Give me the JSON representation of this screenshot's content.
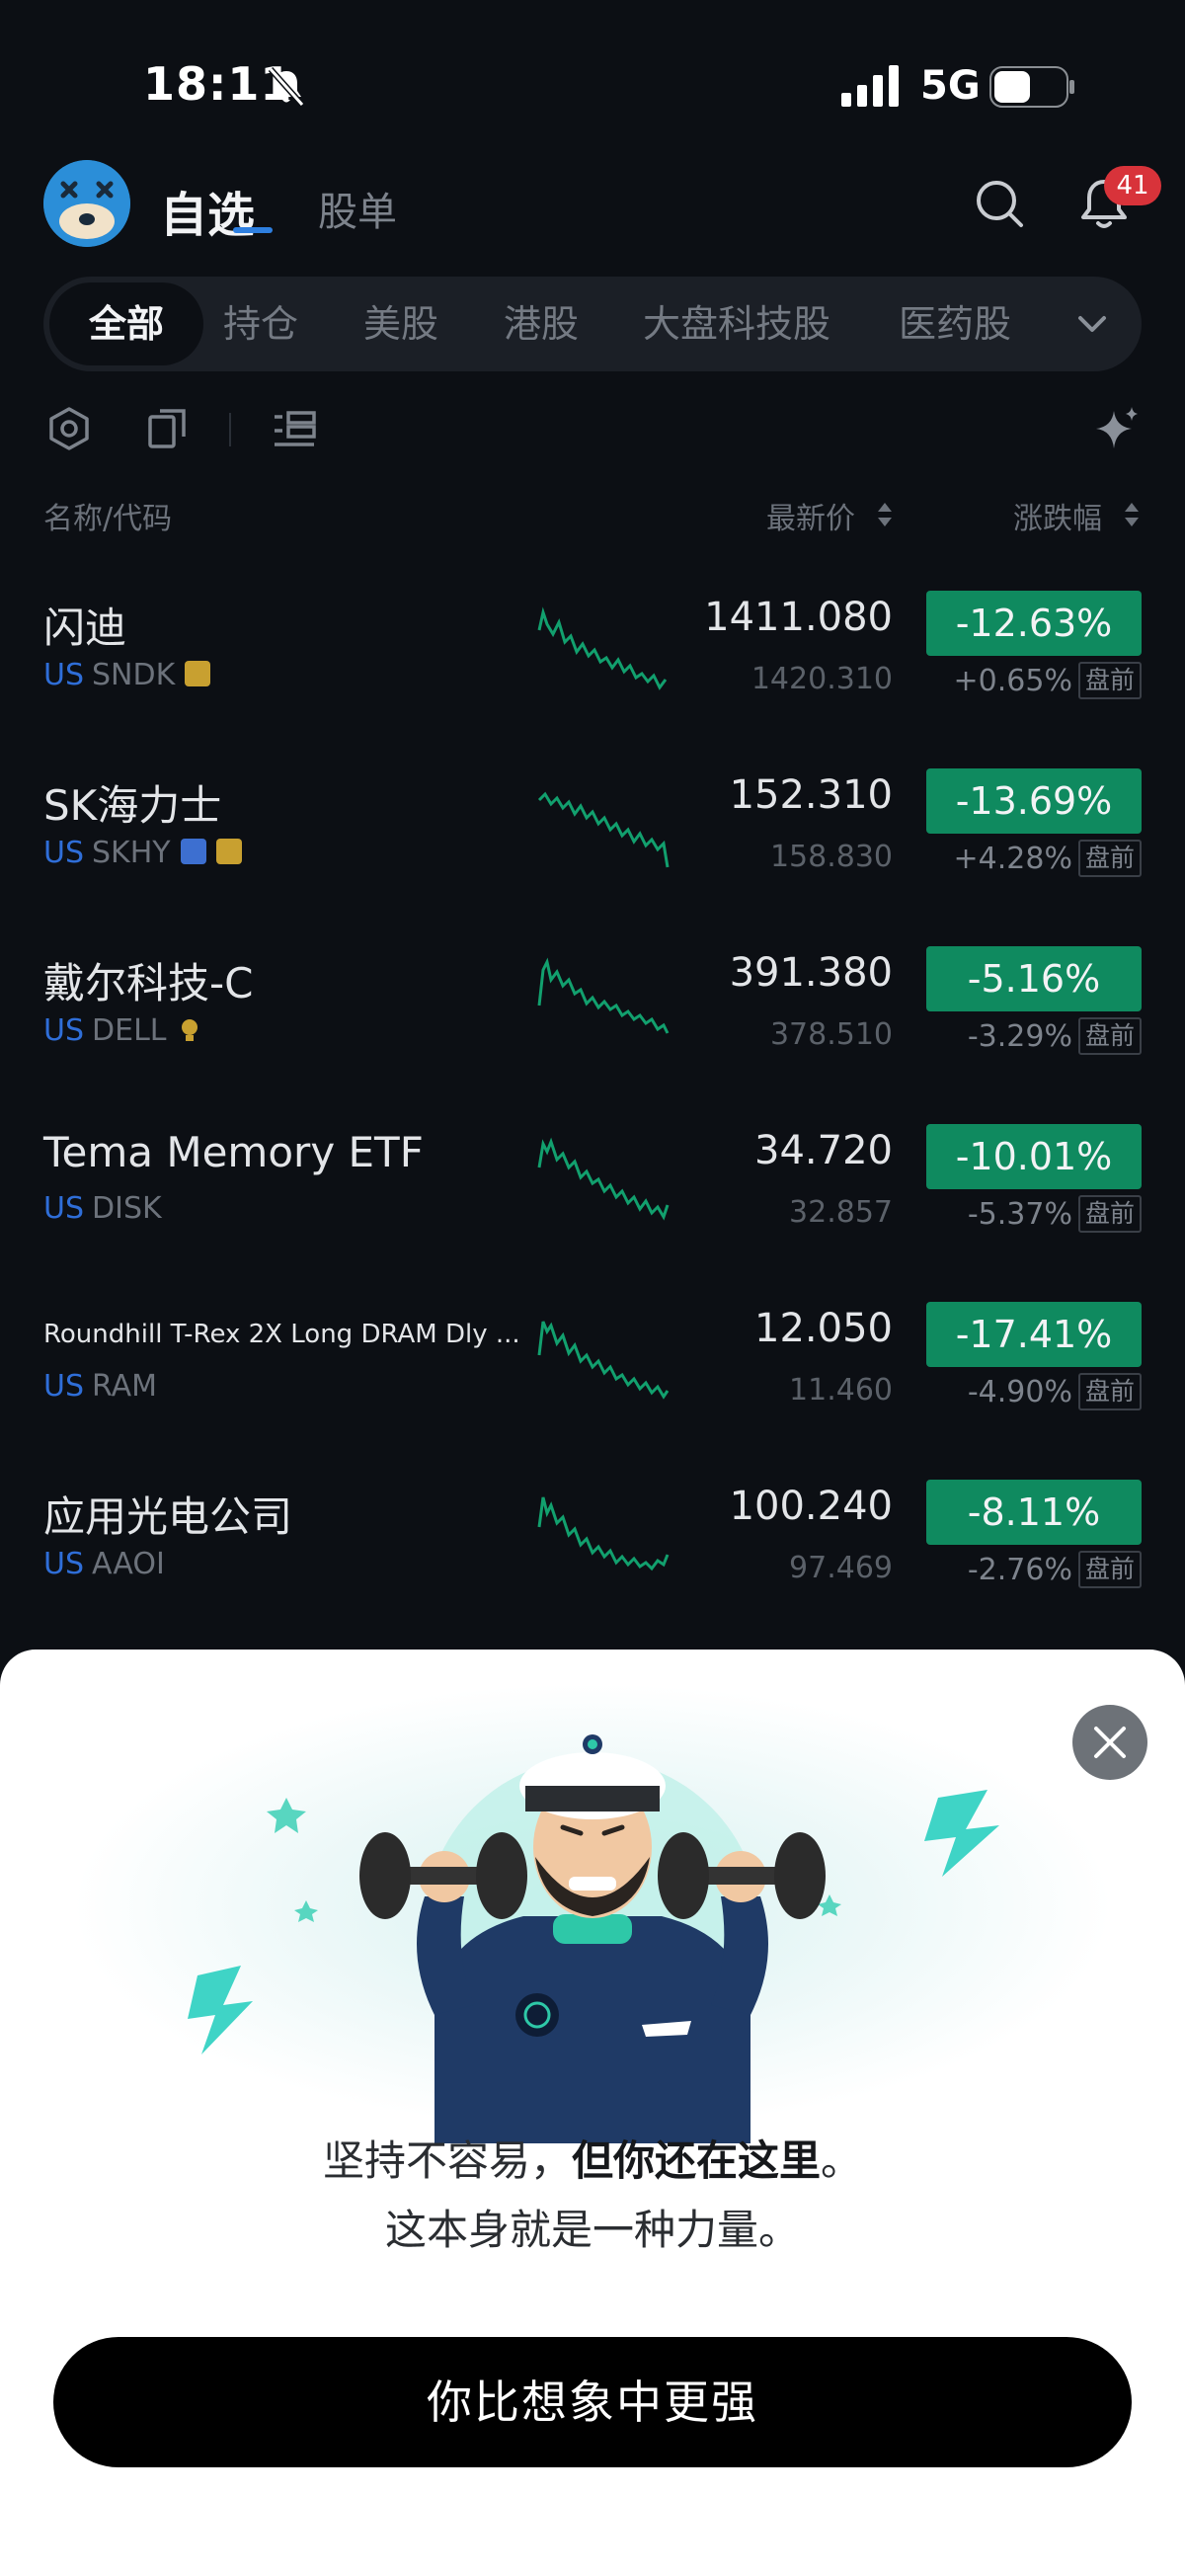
{
  "status_bar": {
    "time": "18:11",
    "network": "5G"
  },
  "header": {
    "tab_watchlist": "自选",
    "tab_lists": "股单",
    "notification_count": "41"
  },
  "categories": [
    {
      "label": "全部",
      "active": true
    },
    {
      "label": "持仓"
    },
    {
      "label": "美股"
    },
    {
      "label": "港股"
    },
    {
      "label": "大盘科技股"
    },
    {
      "label": "医药股"
    }
  ],
  "columns": {
    "name": "名称/代码",
    "price": "最新价",
    "change": "涨跌幅"
  },
  "rows": [
    {
      "name": "闪迪",
      "market": "US",
      "code": "SNDK",
      "price": "1411.080",
      "pre_price": "1420.310",
      "change": "-12.63%",
      "pre_change": "+0.65%",
      "pre_label": "盘前",
      "tags": [
        "calendar"
      ]
    },
    {
      "name": "SK海力士",
      "market": "US",
      "code": "SKHY",
      "price": "152.310",
      "pre_price": "158.830",
      "change": "-13.69%",
      "pre_change": "+4.28%",
      "pre_label": "盘前",
      "tags": [
        "video",
        "calendar"
      ]
    },
    {
      "name": "戴尔科技-C",
      "market": "US",
      "code": "DELL",
      "price": "391.380",
      "pre_price": "378.510",
      "change": "-5.16%",
      "pre_change": "-3.29%",
      "pre_label": "盘前",
      "tags": [
        "bulb"
      ]
    },
    {
      "name": "Tema Memory ETF",
      "market": "US",
      "code": "DISK",
      "price": "34.720",
      "pre_price": "32.857",
      "change": "-10.01%",
      "pre_change": "-5.37%",
      "pre_label": "盘前",
      "tags": []
    },
    {
      "name": "Roundhill T-Rex 2X Long DRAM Dly ...",
      "market": "US",
      "code": "RAM",
      "price": "12.050",
      "pre_price": "11.460",
      "change": "-17.41%",
      "pre_change": "-4.90%",
      "pre_label": "盘前",
      "tags": []
    },
    {
      "name": "应用光电公司",
      "market": "US",
      "code": "AAOI",
      "price": "100.240",
      "pre_price": "97.469",
      "change": "-8.11%",
      "pre_change": "-2.76%",
      "pre_label": "盘前",
      "tags": []
    }
  ],
  "sheet": {
    "line1_normal": "坚持不容易，",
    "line1_bold": "但你还在这里",
    "line1_end": "。",
    "line2": "这本身就是一种力量。",
    "cta": "你比想象中更强"
  },
  "colors": {
    "background": "#0c0f14",
    "down_badge": "#0f8a5f",
    "market_blue": "#2f6ed8",
    "badge_red": "#d8333a"
  },
  "icons": [
    "bell-mute-icon",
    "signal-icon",
    "battery-icon",
    "search-icon",
    "bell-icon",
    "chevron-down-icon",
    "settings-hex-icon",
    "copy-icon",
    "list-layout-icon",
    "sparkle-icon",
    "sort-icon",
    "close-icon"
  ]
}
